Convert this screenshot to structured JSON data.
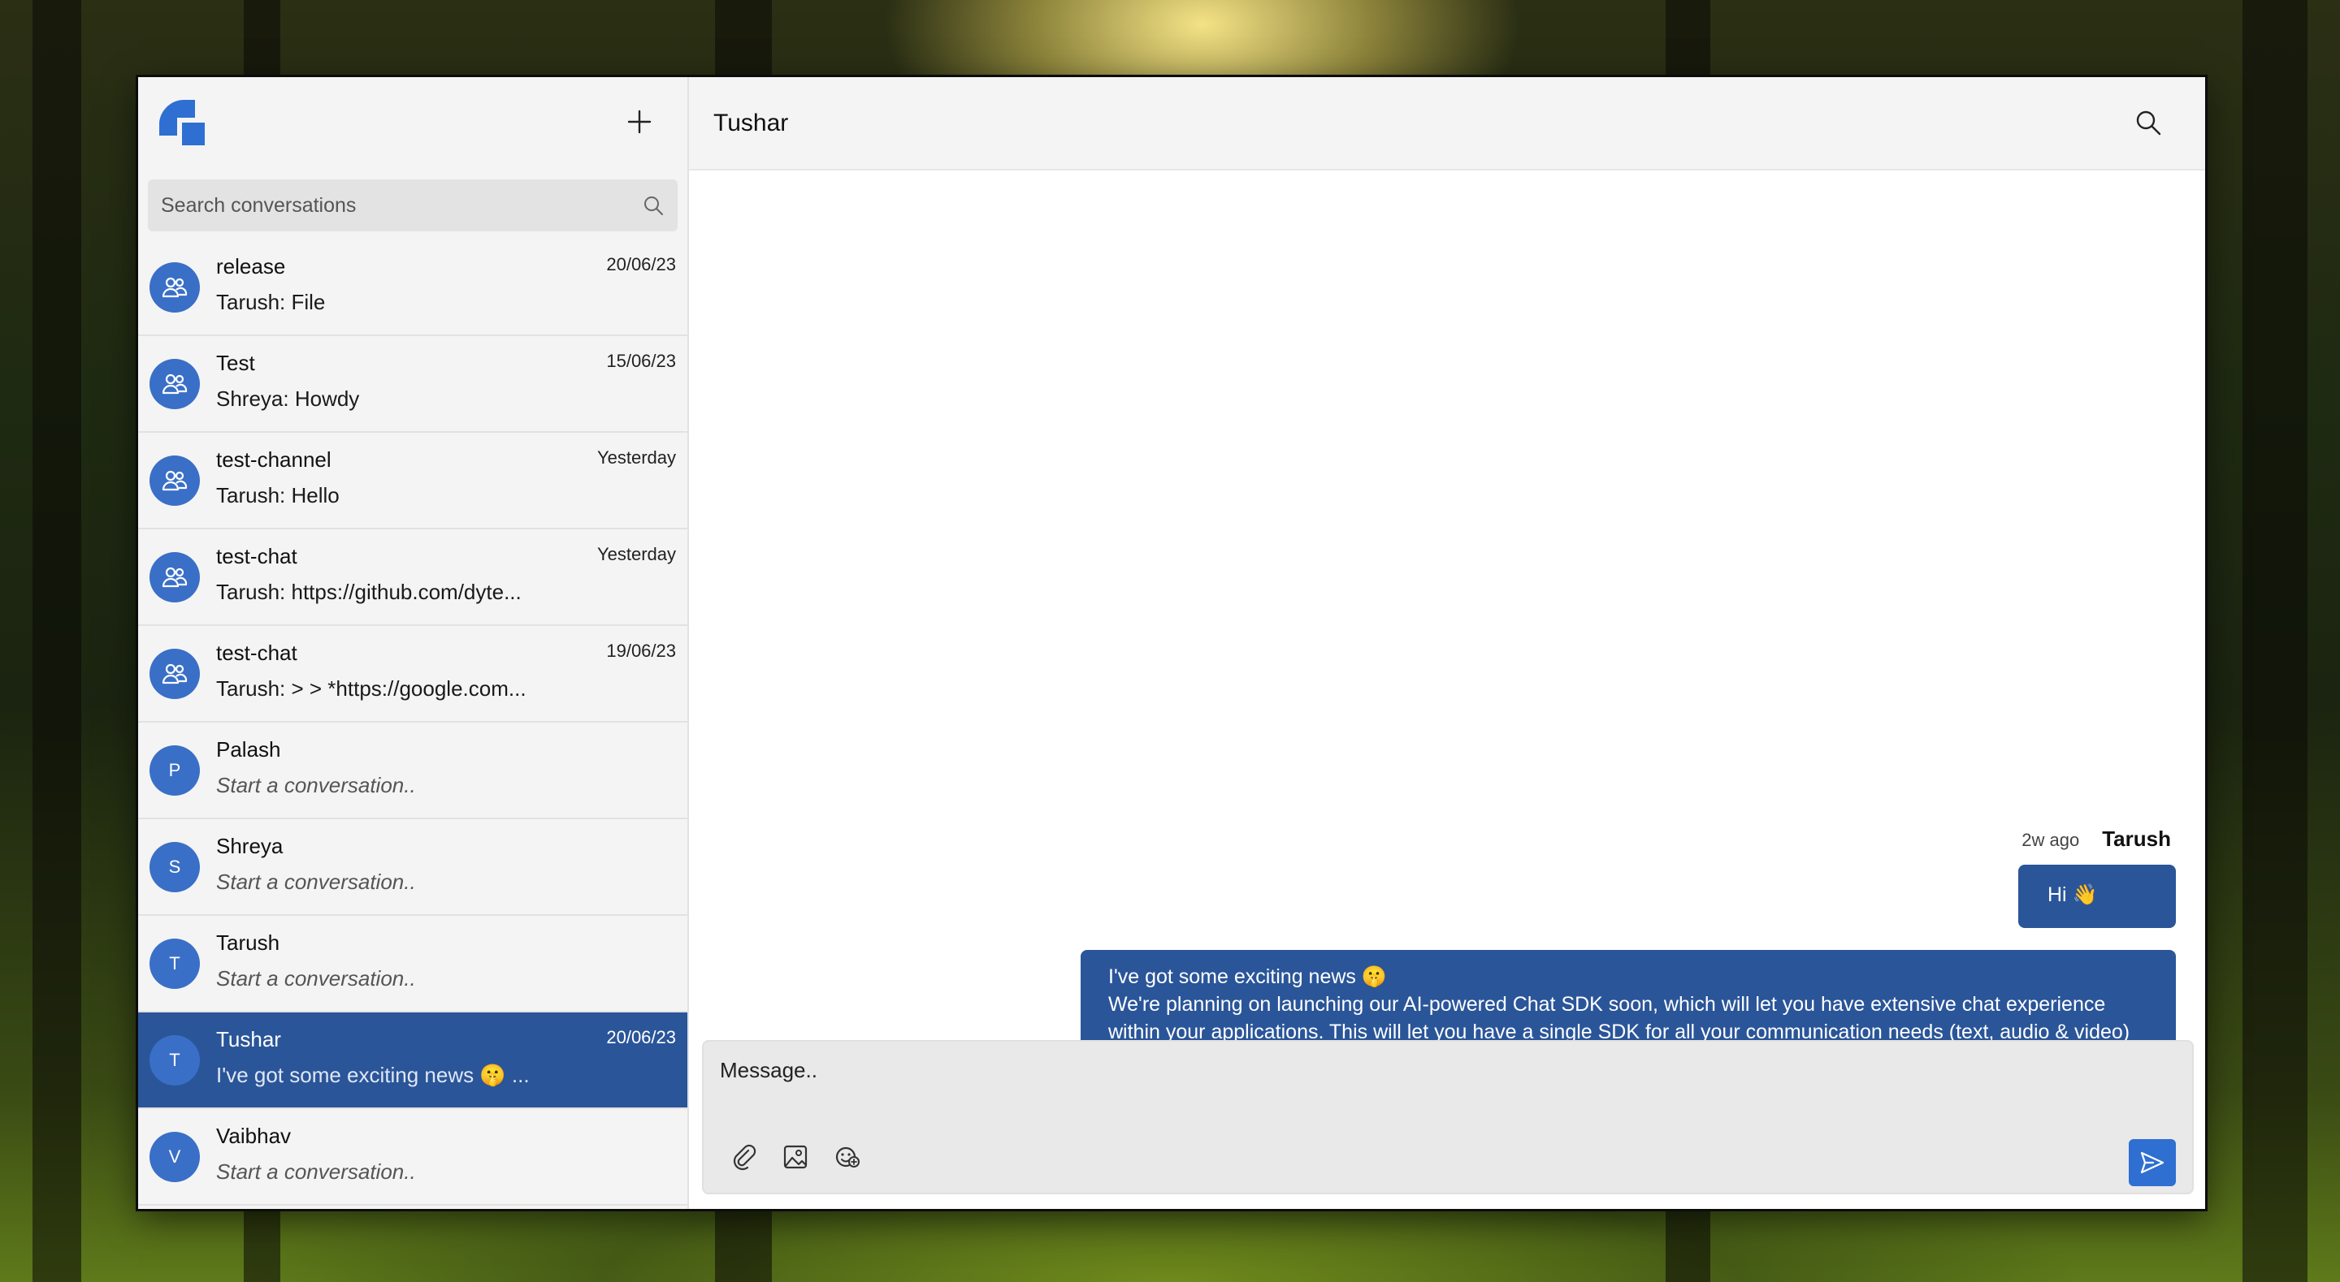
{
  "sidebar": {
    "new_chat_icon": "plus-icon",
    "search": {
      "placeholder": "Search conversations"
    },
    "conversations": [
      {
        "name": "release",
        "date": "20/06/23",
        "preview": "Tarush: File",
        "type": "group"
      },
      {
        "name": "Test",
        "date": "15/06/23",
        "preview": "Shreya: Howdy",
        "type": "group"
      },
      {
        "name": "test-channel",
        "date": "Yesterday",
        "preview": "Tarush: Hello",
        "type": "group"
      },
      {
        "name": "test-chat",
        "date": "Yesterday",
        "preview": "Tarush: https://github.com/dyte...",
        "type": "group"
      },
      {
        "name": "test-chat",
        "date": "19/06/23",
        "preview": "Tarush: > > *https://google.com...",
        "type": "group"
      },
      {
        "name": "Palash",
        "initial": "P",
        "date": "",
        "preview": "Start a conversation..",
        "type": "user"
      },
      {
        "name": "Shreya",
        "initial": "S",
        "date": "",
        "preview": "Start a conversation..",
        "type": "user"
      },
      {
        "name": "Tarush",
        "initial": "T",
        "date": "",
        "preview": "Start a conversation..",
        "type": "user"
      },
      {
        "name": "Tushar",
        "initial": "T",
        "date": "20/06/23",
        "preview": "I've got some exciting news 🤫 ...",
        "type": "user",
        "active": true
      },
      {
        "name": "Vaibhav",
        "initial": "V",
        "date": "",
        "preview": "Start a conversation..",
        "type": "user"
      }
    ]
  },
  "chat": {
    "title": "Tushar",
    "search_icon": "search-icon",
    "messages": {
      "time": "2w ago",
      "sender": "Tarush",
      "first": "Hi 👋",
      "second_line1": "I've got some exciting news 🤫",
      "second_line2": "We're planning on launching our AI-powered Chat SDK soon, which will let you have extensive chat experience within your applications. This will let you have a single SDK for all your communication needs (text, audio & video)"
    },
    "composer": {
      "placeholder": "Message..",
      "tools": [
        "attachment-icon",
        "image-icon",
        "emoji-icon"
      ],
      "send_icon": "send-icon"
    }
  },
  "colors": {
    "accent": "#2a5599",
    "avatar": "#3a6fc7",
    "send_button": "#2f6fd1",
    "sidebar_bg": "#f4f4f4"
  }
}
